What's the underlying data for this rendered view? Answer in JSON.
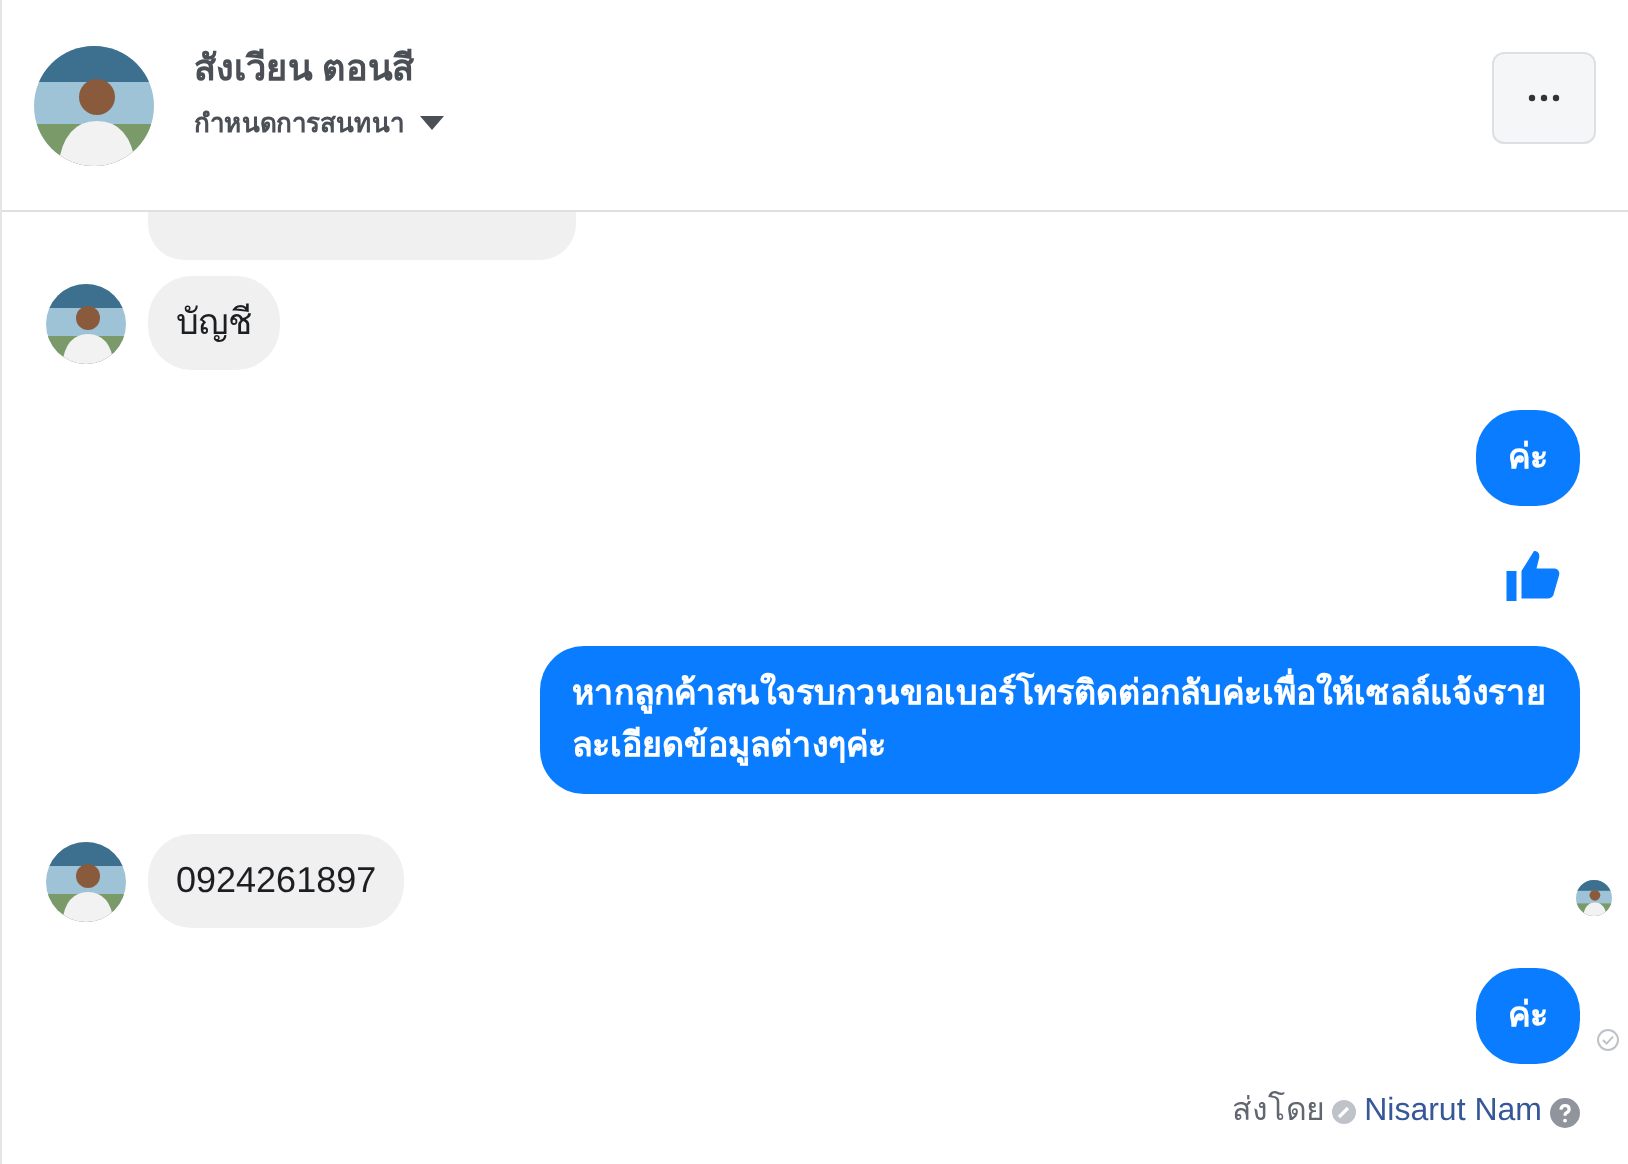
{
  "header": {
    "name": "สังเวียน ตอนสี",
    "subtitle": "กำหนดการสนทนา"
  },
  "messages": [
    {
      "kind": "received_cut"
    },
    {
      "kind": "received",
      "text": "บัญชี",
      "show_avatar": true
    },
    {
      "kind": "sent",
      "text": "ค่ะ"
    },
    {
      "kind": "like"
    },
    {
      "kind": "sent",
      "text": "หากลูกค้าสนใจรบกวนขอเบอร์โทรติดต่อกลับค่ะเพื่อให้เซลล์แจ้งรายละเอียดข้อมูลต่างๆค่ะ"
    },
    {
      "kind": "received",
      "text": "0924261897",
      "show_avatar": true,
      "seen": true
    },
    {
      "kind": "sent",
      "text": "ค่ะ",
      "delivered": true
    }
  ],
  "sent_by": {
    "label": "ส่งโดย",
    "name": "Nisarut Nam"
  }
}
